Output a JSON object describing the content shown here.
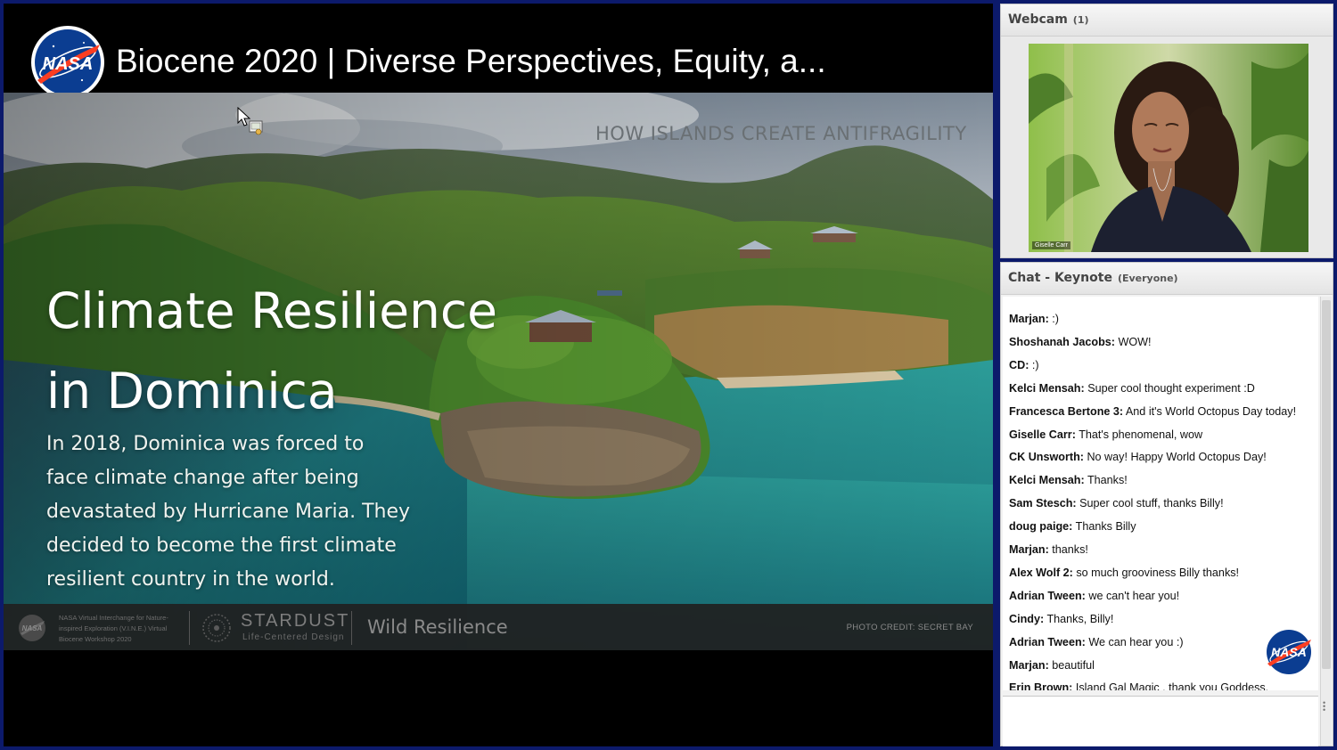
{
  "video": {
    "title": "Biocene 2020 | Diverse Perspectives, Equity, a...",
    "logo_icon": "nasa-meatball-icon"
  },
  "slide": {
    "kicker": "HOW ISLANDS CREATE ANTIFRAGILITY",
    "heading_line1": "Climate Resilience",
    "heading_line2": "in Dominica",
    "body": "In 2018, Dominica was forced to face climate change after being devastated by Hurricane Maria. They decided to become the first climate resilient country in the world.",
    "footer": {
      "nasa_logo": "NASA",
      "vine_text": "NASA Virtual Interchange for Nature-inspired Exploration (V.I.N.E.) Virtual Biocene Workshop 2020",
      "stardust": "STARDUST",
      "stardust_sub": "Life-Centered Design",
      "wild": "Wild Resilience",
      "credit": "PHOTO CREDIT: SECRET BAY"
    }
  },
  "webcam": {
    "title": "Webcam",
    "count": "(1)",
    "name_tag": "Giselle Carr"
  },
  "chat": {
    "title": "Chat - Keynote",
    "audience": "(Everyone)",
    "messages": [
      {
        "author": "Marjan:",
        "text": ":)"
      },
      {
        "author": "Shoshanah Jacobs:",
        "text": "WOW!"
      },
      {
        "author": "CD:",
        "text": ":)"
      },
      {
        "author": "Kelci Mensah:",
        "text": "Super cool thought experiment :D"
      },
      {
        "author": "Francesca Bertone 3:",
        "text": "And it's World Octopus Day today!"
      },
      {
        "author": "Giselle Carr:",
        "text": "That's phenomenal, wow"
      },
      {
        "author": "CK Unsworth:",
        "text": "No way! Happy World Octopus Day!"
      },
      {
        "author": "Kelci Mensah:",
        "text": "Thanks!"
      },
      {
        "author": "Sam Stesch:",
        "text": "Super cool stuff, thanks Billy!"
      },
      {
        "author": "doug paige:",
        "text": "Thanks Billy"
      },
      {
        "author": "Marjan:",
        "text": "thanks!"
      },
      {
        "author": "Alex Wolf 2:",
        "text": "so much grooviness Billy thanks!"
      },
      {
        "author": "Adrian Tween:",
        "text": "we can't hear you!"
      },
      {
        "author": "Cindy:",
        "text": "Thanks, Billy!"
      },
      {
        "author": "Adrian Tween:",
        "text": "We can hear you :)"
      },
      {
        "author": "Marjan:",
        "text": "beautiful"
      },
      {
        "author": "Erin Brown:",
        "text": "Island Gal Magic , thank you Goddess."
      }
    ],
    "watermark": "NASA"
  },
  "colors": {
    "frame": "#0c1a6b",
    "nasa_blue": "#0b3d91",
    "nasa_red": "#fc3d21"
  }
}
